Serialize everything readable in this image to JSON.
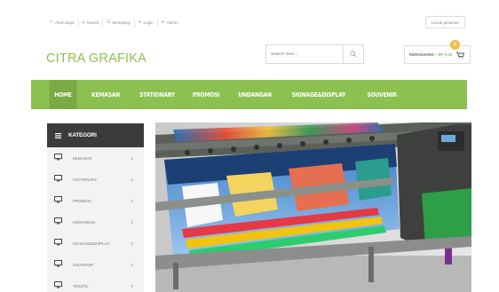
{
  "topbar": {
    "links": [
      {
        "icon": "user-icon",
        "label": "Akun saya"
      },
      {
        "icon": "heart-icon",
        "label": "Favorit"
      },
      {
        "icon": "cart-icon",
        "label": "keranjang"
      },
      {
        "icon": "login-icon",
        "label": "Login"
      },
      {
        "icon": "admin-icon",
        "label": "Admin"
      }
    ],
    "track_label": "Lacak pesanan"
  },
  "brand": "CITRA GRAFIKA",
  "search": {
    "placeholder": "Search here..."
  },
  "cart": {
    "label": "KERANJANG -",
    "amount": "RP 0,00",
    "count": "0"
  },
  "nav": {
    "items": [
      {
        "label": "HOME",
        "active": true
      },
      {
        "label": "KEMASAN"
      },
      {
        "label": "STATIONARY"
      },
      {
        "label": "PROMOSI"
      },
      {
        "label": "UNDANGAN"
      },
      {
        "label": "SIGNAGE&DISPLAY"
      },
      {
        "label": "SOUVENIR"
      }
    ]
  },
  "sidebar": {
    "title": "KATEGORI",
    "items": [
      {
        "label": "KEMASAN",
        "count": "0"
      },
      {
        "label": "STATIONARY",
        "count": "0"
      },
      {
        "label": "PROMOSI",
        "count": "0"
      },
      {
        "label": "UNDANGAN",
        "count": "0"
      },
      {
        "label": "SIGNAGE&DISPLAY",
        "count": "0"
      },
      {
        "label": "SOUVENIR",
        "count": "0"
      },
      {
        "label": "TEKSTIL",
        "count": "0"
      }
    ]
  },
  "colors": {
    "brand": "#8cc152",
    "nav_active": "#79aa43",
    "sidebar_head": "#3b3b3b",
    "badge": "#f6bb42"
  }
}
